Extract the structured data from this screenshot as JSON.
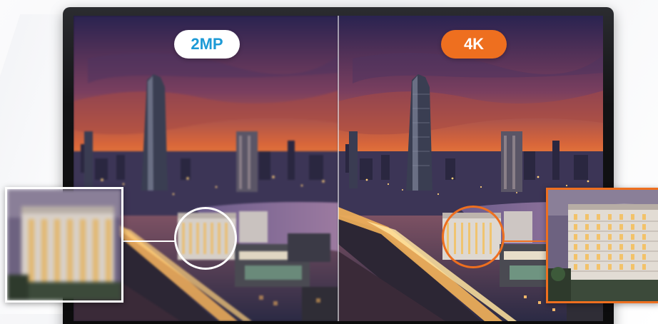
{
  "comparison": {
    "left_label": "2MP",
    "right_label": "4K"
  },
  "colors": {
    "badge_left_bg": "#ffffff",
    "badge_left_text": "#1d9ad6",
    "badge_right_bg": "#ee6f1f",
    "badge_right_text": "#ffffff",
    "ring_left": "#ffffff",
    "ring_right": "#ee6f1f"
  },
  "images": {
    "scene": "city-skyline-sunset-photo",
    "inset": "hotel-building-closeup-photo"
  }
}
